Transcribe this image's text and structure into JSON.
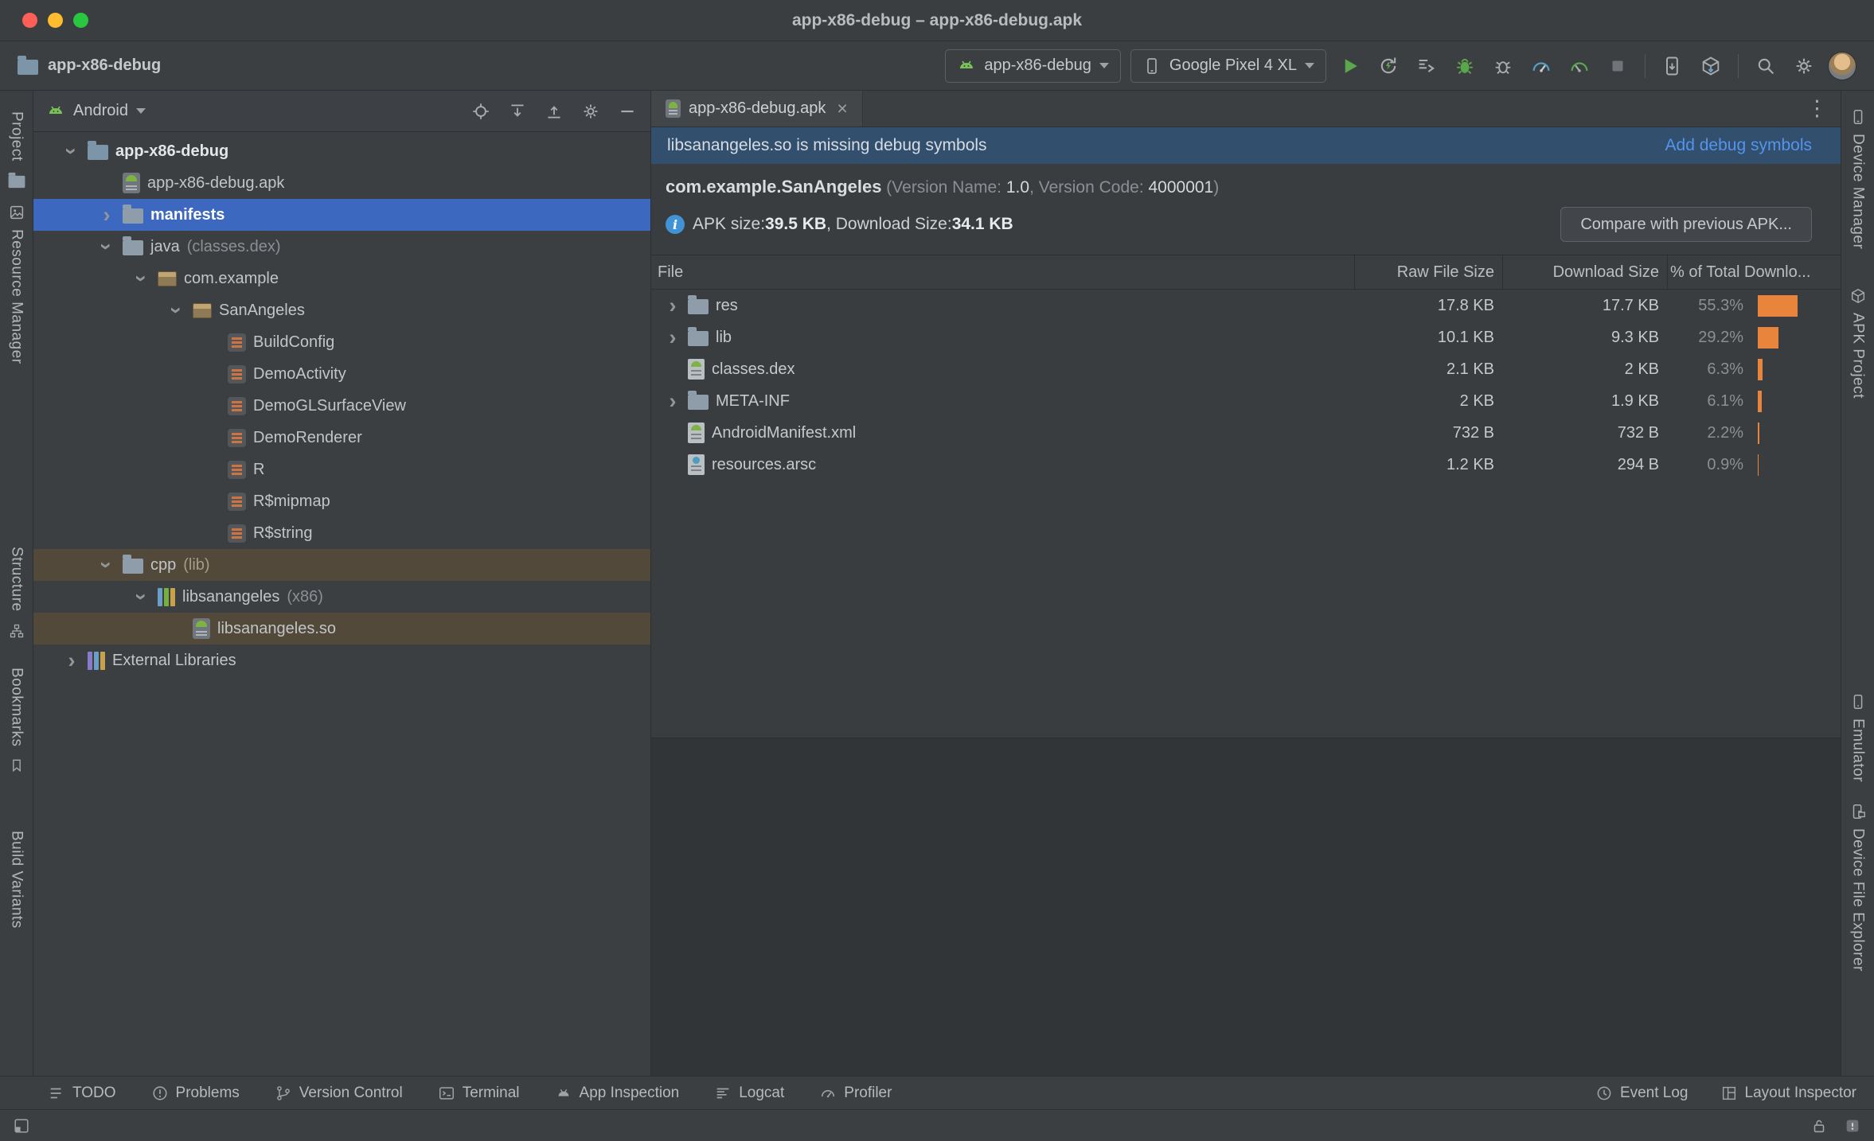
{
  "colors": {
    "selection-blue": "#3D68C0",
    "row-brown": "#52493B",
    "bar-orange": "#E8843C",
    "link-blue": "#5394EC",
    "banner-blue": "#32506E",
    "run-green": "#5BA74B"
  },
  "titlebar": {
    "title": "app-x86-debug – app-x86-debug.apk"
  },
  "toolbar": {
    "project_name": "app-x86-debug",
    "run_config": "app-x86-debug",
    "device": "Google Pixel 4 XL"
  },
  "left_stripe": {
    "tabs": [
      "Project",
      "Resource Manager",
      "Structure",
      "Bookmarks",
      "Build Variants"
    ]
  },
  "right_stripe": {
    "tabs": [
      "Device Manager",
      "APK Project",
      "Emulator",
      "Device File Explorer"
    ]
  },
  "project_panel": {
    "view": "Android",
    "tree": [
      {
        "label": "app-x86-debug"
      },
      {
        "label": "app-x86-debug.apk"
      },
      {
        "label": "manifests"
      },
      {
        "label": "java",
        "hint": "(classes.dex)"
      },
      {
        "label": "com.example"
      },
      {
        "label": "SanAngeles"
      },
      {
        "label": "BuildConfig"
      },
      {
        "label": "DemoActivity"
      },
      {
        "label": "DemoGLSurfaceView"
      },
      {
        "label": "DemoRenderer"
      },
      {
        "label": "R"
      },
      {
        "label": "R$mipmap"
      },
      {
        "label": "R$string"
      },
      {
        "label": "cpp",
        "hint": "(lib)"
      },
      {
        "label": "libsanangeles",
        "hint": "(x86)"
      },
      {
        "label": "libsanangeles.so"
      },
      {
        "label": "External Libraries"
      }
    ]
  },
  "editor": {
    "tab": "app-x86-debug.apk",
    "banner": {
      "message": "libsanangeles.so is missing debug symbols",
      "action": "Add debug symbols"
    },
    "apk_info": {
      "package": "com.example.SanAngeles",
      "meta_1": "(Version Name: ",
      "version_name": "1.0",
      "meta_2": ", Version Code: ",
      "version_code": "4000001",
      "meta_3": ")",
      "size_label": "APK size: ",
      "apk_size": "39.5 KB",
      "download_label": ", Download Size: ",
      "download_size": "34.1 KB",
      "compare_button": "Compare with previous APK..."
    },
    "table": {
      "columns": [
        "File",
        "Raw File Size",
        "Download Size",
        "% of Total Downlo..."
      ],
      "rows": [
        {
          "file": "res",
          "raw": "17.8 KB",
          "download": "17.7 KB",
          "percent": "55.3%",
          "bar": 55.3
        },
        {
          "file": "lib",
          "raw": "10.1 KB",
          "download": "9.3 KB",
          "percent": "29.2%",
          "bar": 29.2
        },
        {
          "file": "classes.dex",
          "raw": "2.1 KB",
          "download": "2 KB",
          "percent": "6.3%",
          "bar": 6.3
        },
        {
          "file": "META-INF",
          "raw": "2 KB",
          "download": "1.9 KB",
          "percent": "6.1%",
          "bar": 6.1
        },
        {
          "file": "AndroidManifest.xml",
          "raw": "732 B",
          "download": "732 B",
          "percent": "2.2%",
          "bar": 2.2
        },
        {
          "file": "resources.arsc",
          "raw": "1.2 KB",
          "download": "294 B",
          "percent": "0.9%",
          "bar": 0.9
        }
      ]
    }
  },
  "bottom_bar": {
    "left": [
      "TODO",
      "Problems",
      "Version Control",
      "Terminal",
      "App Inspection",
      "Logcat",
      "Profiler"
    ],
    "right": [
      "Event Log",
      "Layout Inspector"
    ]
  }
}
